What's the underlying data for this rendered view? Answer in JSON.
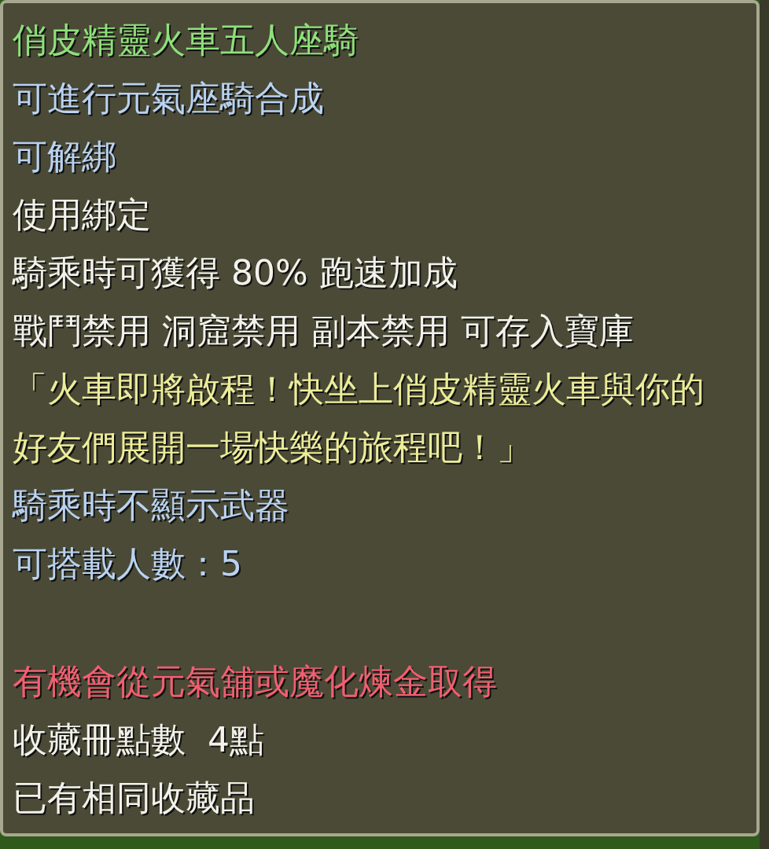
{
  "tooltip": {
    "lines": [
      {
        "kind": "title",
        "text": "俏皮精靈火車五人座騎"
      },
      {
        "kind": "info",
        "text": "可進行元氣座騎合成"
      },
      {
        "kind": "info",
        "text": "可解綁"
      },
      {
        "kind": "plain",
        "text": "使用綁定"
      },
      {
        "kind": "plain",
        "text": "騎乘時可獲得 80% 跑速加成"
      },
      {
        "kind": "plain",
        "text": "戰鬥禁用 洞窟禁用 副本禁用 可存入寶庫"
      },
      {
        "kind": "quote",
        "text": "「火車即將啟程！快坐上俏皮精靈火車與你的"
      },
      {
        "kind": "quote",
        "text": "好友們展開一場快樂的旅程吧！」"
      },
      {
        "kind": "info",
        "text": "騎乘時不顯示武器"
      },
      {
        "kind": "info",
        "text": "可搭載人數：5"
      },
      {
        "kind": "source",
        "text": "有機會從元氣舖或魔化煉金取得"
      },
      {
        "kind": "plain",
        "text": "收藏冊點數  4點"
      },
      {
        "kind": "plain",
        "text": "已有相同收藏品"
      }
    ]
  }
}
